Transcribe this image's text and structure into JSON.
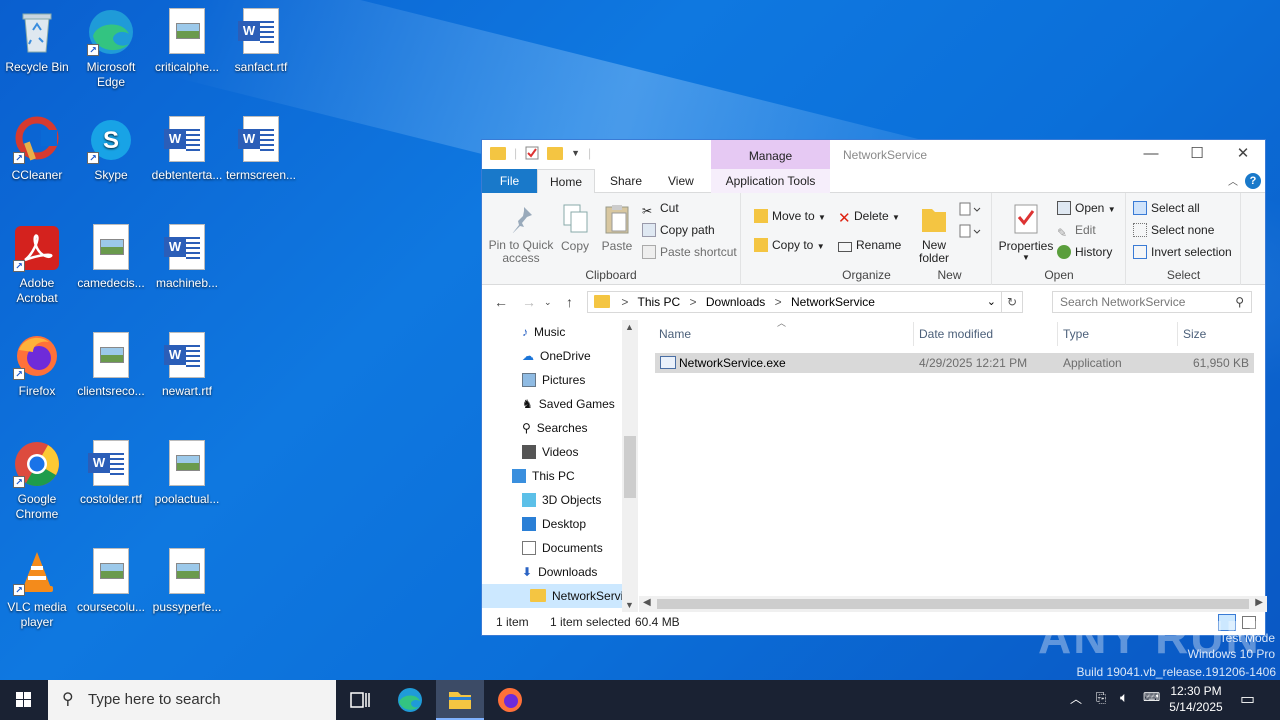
{
  "desktop": {
    "icons": [
      {
        "label": "Recycle Bin"
      },
      {
        "label": "Microsoft Edge"
      },
      {
        "label": "criticalphe..."
      },
      {
        "label": "sanfact.rtf"
      },
      {
        "label": "CCleaner"
      },
      {
        "label": "Skype"
      },
      {
        "label": "debtenterta..."
      },
      {
        "label": "termscreen..."
      },
      {
        "label": "Adobe Acrobat"
      },
      {
        "label": "camedecis..."
      },
      {
        "label": "machineb..."
      },
      {
        "label": "Firefox"
      },
      {
        "label": "clientsreco..."
      },
      {
        "label": "newart.rtf"
      },
      {
        "label": "Google Chrome"
      },
      {
        "label": "costolder.rtf"
      },
      {
        "label": "poolactual..."
      },
      {
        "label": "VLC media player"
      },
      {
        "label": "coursecolu..."
      },
      {
        "label": "pussyperfe..."
      }
    ]
  },
  "explorer": {
    "title": "NetworkService",
    "manage_tab": "Manage",
    "tabs": {
      "file": "File",
      "home": "Home",
      "share": "Share",
      "view": "View",
      "app_tools": "Application Tools"
    },
    "ribbon": {
      "clipboard": {
        "pin": "Pin to Quick access",
        "copy": "Copy",
        "paste": "Paste",
        "cut": "Cut",
        "copy_path": "Copy path",
        "paste_shortcut": "Paste shortcut",
        "label": "Clipboard"
      },
      "organize": {
        "move_to": "Move to",
        "copy_to": "Copy to",
        "delete": "Delete",
        "rename": "Rename",
        "label": "Organize"
      },
      "new": {
        "new_folder": "New folder",
        "label": "New"
      },
      "open": {
        "properties": "Properties",
        "open": "Open",
        "edit": "Edit",
        "history": "History",
        "label": "Open"
      },
      "select": {
        "select_all": "Select all",
        "select_none": "Select none",
        "invert": "Invert selection",
        "label": "Select"
      }
    },
    "address": {
      "crumbs": [
        "This PC",
        "Downloads",
        "NetworkService"
      ],
      "separator": ">"
    },
    "search": {
      "placeholder": "Search NetworkService"
    },
    "nav": [
      {
        "label": "Music",
        "icon": "music-icon"
      },
      {
        "label": "OneDrive",
        "icon": "onedrive-icon"
      },
      {
        "label": "Pictures",
        "icon": "pictures-icon"
      },
      {
        "label": "Saved Games",
        "icon": "saved-games-icon"
      },
      {
        "label": "Searches",
        "icon": "searches-icon"
      },
      {
        "label": "Videos",
        "icon": "videos-icon"
      },
      {
        "label": "This PC",
        "icon": "this-pc-icon"
      },
      {
        "label": "3D Objects",
        "icon": "3d-objects-icon"
      },
      {
        "label": "Desktop",
        "icon": "desktop-icon"
      },
      {
        "label": "Documents",
        "icon": "documents-icon"
      },
      {
        "label": "Downloads",
        "icon": "downloads-icon"
      },
      {
        "label": "NetworkServi",
        "icon": "folder-icon"
      }
    ],
    "columns": {
      "name": "Name",
      "date": "Date modified",
      "type": "Type",
      "size": "Size"
    },
    "files": [
      {
        "name": "NetworkService.exe",
        "date": "4/29/2025 12:21 PM",
        "type": "Application",
        "size": "61,950 KB"
      }
    ],
    "status": {
      "count": "1 item",
      "selected": "1 item selected",
      "size": "60.4 MB"
    }
  },
  "watermark": {
    "line1": "Test Mode",
    "line2": "Windows 10 Pro",
    "line3": "Build 19041.vb_release.191206-1406",
    "brand": "ANY RUN"
  },
  "taskbar": {
    "search_placeholder": "Type here to search",
    "time": "12:30 PM",
    "date": "5/14/2025"
  },
  "colors": {
    "accent": "#1979ca",
    "manage": "#e6c9f3",
    "selection": "#d9d9d9"
  }
}
